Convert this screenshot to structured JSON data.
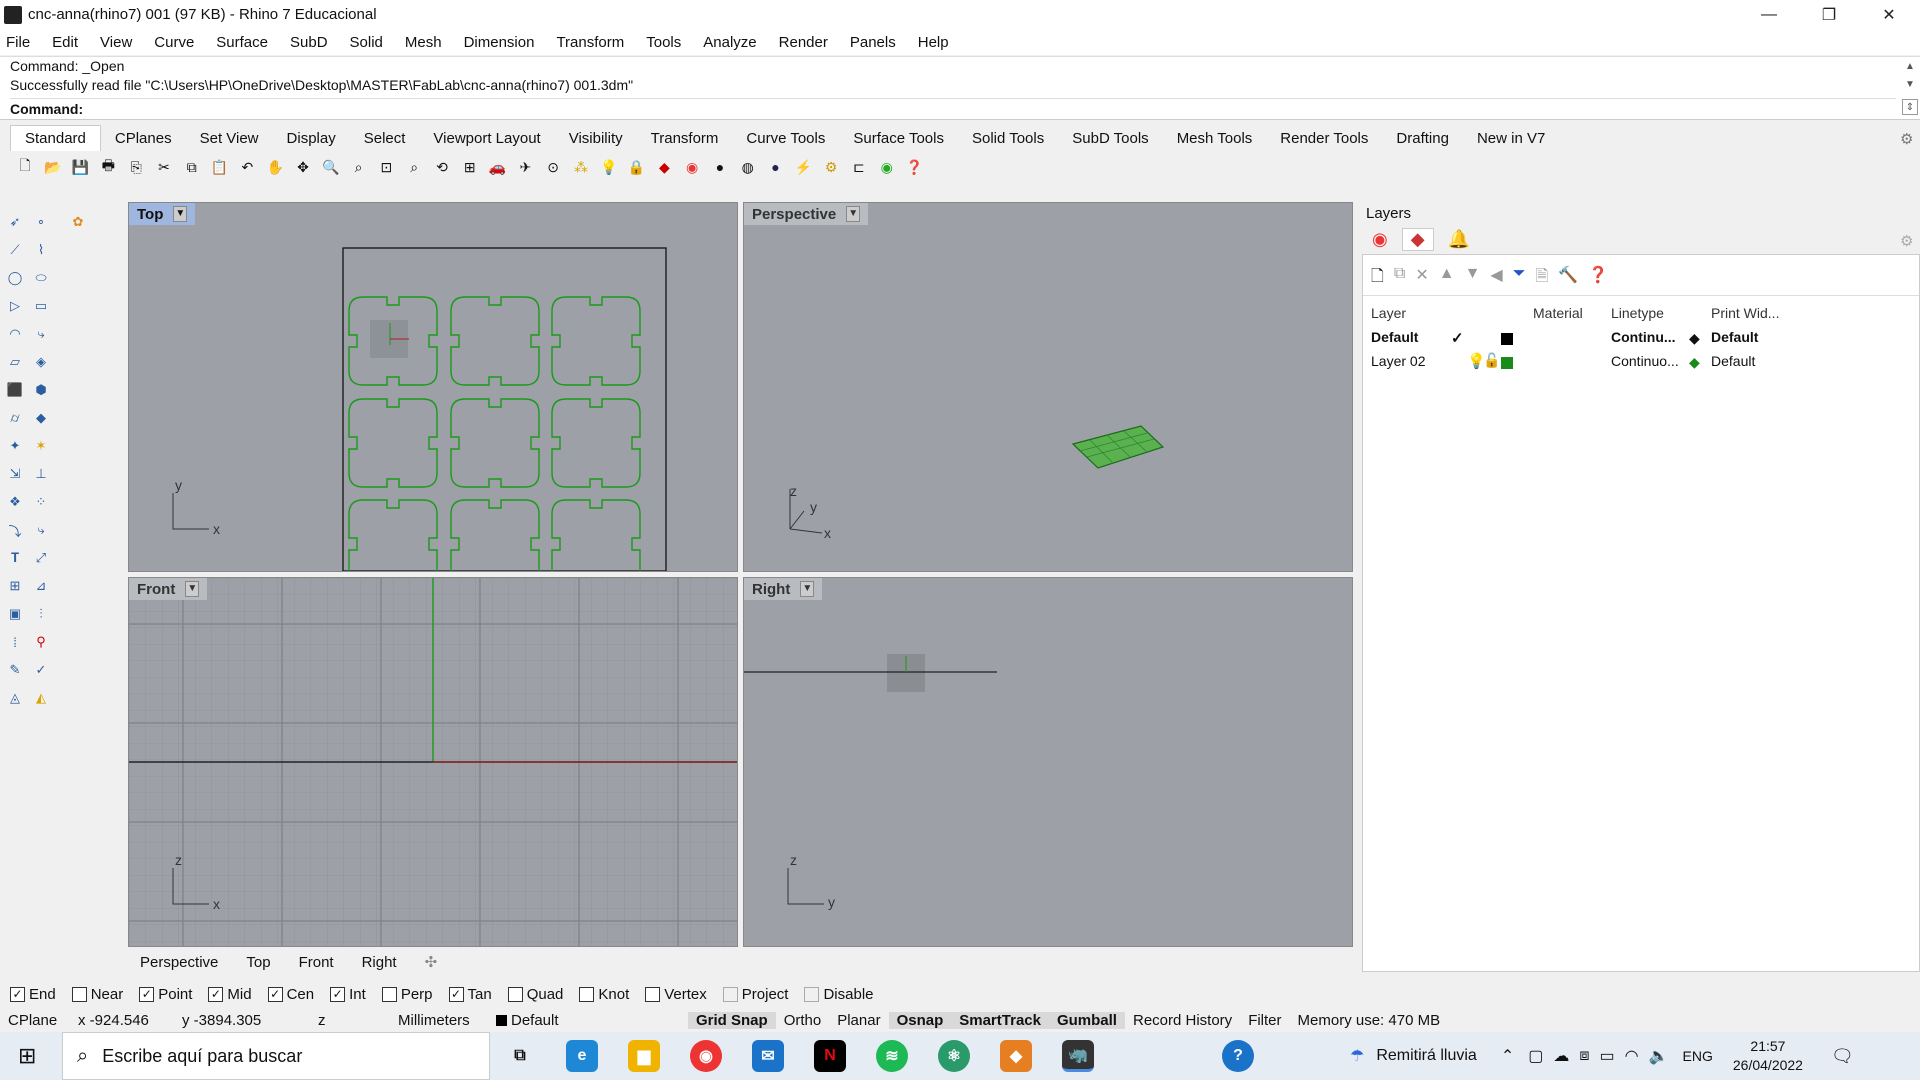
{
  "window": {
    "title": "cnc-anna(rhino7) 001 (97 KB) - Rhino 7 Educacional",
    "minimize": "—",
    "maximize": "❐",
    "close": "✕"
  },
  "menu": [
    "File",
    "Edit",
    "View",
    "Curve",
    "Surface",
    "SubD",
    "Solid",
    "Mesh",
    "Dimension",
    "Transform",
    "Tools",
    "Analyze",
    "Render",
    "Panels",
    "Help"
  ],
  "command": {
    "line1": "Command: _Open",
    "line2": "Successfully read file \"C:\\Users\\HP\\OneDrive\\Desktop\\MASTER\\FabLab\\cnc-anna(rhino7) 001.3dm\"",
    "prompt": "Command:"
  },
  "toolbar_tabs": [
    "Standard",
    "CPlanes",
    "Set View",
    "Display",
    "Select",
    "Viewport Layout",
    "Visibility",
    "Transform",
    "Curve Tools",
    "Surface Tools",
    "Solid Tools",
    "SubD Tools",
    "Mesh Tools",
    "Render Tools",
    "Drafting",
    "New in V7"
  ],
  "viewports": {
    "top": {
      "label": "Top",
      "x": "x",
      "y": "y"
    },
    "perspective": {
      "label": "Perspective",
      "x": "x",
      "y": "y",
      "z": "z"
    },
    "front": {
      "label": "Front",
      "x": "x",
      "z": "z"
    },
    "right": {
      "label": "Right",
      "y": "y",
      "z": "z"
    }
  },
  "viewport_tabs": [
    "Perspective",
    "Top",
    "Front",
    "Right"
  ],
  "layers": {
    "title": "Layers",
    "headers": [
      "Layer",
      "Material",
      "Linetype",
      "Print Wid..."
    ],
    "rows": [
      {
        "name": "Default",
        "current": "✓",
        "color": "#000000",
        "linetype": "Continu...",
        "print_width": "Default"
      },
      {
        "name": "Layer 02",
        "current": "",
        "color": "#1a8a1a",
        "linetype": "Continuo...",
        "print_width": "Default"
      }
    ]
  },
  "osnaps": [
    {
      "label": "End",
      "checked": true
    },
    {
      "label": "Near",
      "checked": false
    },
    {
      "label": "Point",
      "checked": true
    },
    {
      "label": "Mid",
      "checked": true
    },
    {
      "label": "Cen",
      "checked": true
    },
    {
      "label": "Int",
      "checked": true
    },
    {
      "label": "Perp",
      "checked": false
    },
    {
      "label": "Tan",
      "checked": true
    },
    {
      "label": "Quad",
      "checked": false
    },
    {
      "label": "Knot",
      "checked": false
    },
    {
      "label": "Vertex",
      "checked": false
    },
    {
      "label": "Project",
      "checked": false
    },
    {
      "label": "Disable",
      "checked": false
    }
  ],
  "status": {
    "cplane": "CPlane",
    "x": "x -924.546",
    "y": "y -3894.305",
    "z": "z",
    "units": "Millimeters",
    "layer": "Default",
    "grid_snap": "Grid Snap",
    "ortho": "Ortho",
    "planar": "Planar",
    "osnap": "Osnap",
    "smarttrack": "SmartTrack",
    "gumball": "Gumball",
    "record_history": "Record History",
    "filter": "Filter",
    "memory": "Memory use: 470 MB"
  },
  "taskbar": {
    "search_placeholder": "Escribe aquí para buscar",
    "weather": "Remitirá lluvia",
    "lang": "ENG",
    "time": "21:57",
    "date": "26/04/2022"
  },
  "colors": {
    "accent_green": "#1a9a1a",
    "viewport_bg": "#9da1a7",
    "active_label": "#9fb6e0"
  }
}
